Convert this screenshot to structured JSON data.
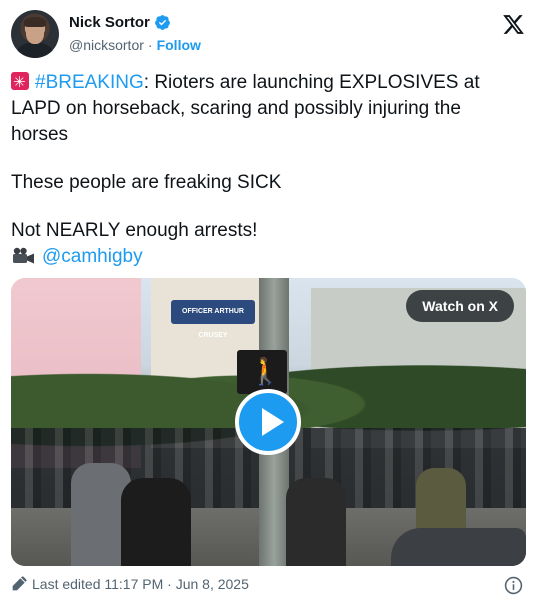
{
  "author": {
    "name": "Nick Sortor",
    "handle": "@nicksortor",
    "separator": "·",
    "follow_label": "Follow"
  },
  "tweet": {
    "line1_hashtag": "#BREAKING",
    "line1_rest": ": Rioters are launching EXPLOSIVES at",
    "line2": "LAPD on horseback, scaring and possibly injuring the",
    "line3": "horses",
    "line4": "These people are freaking SICK",
    "line5": "Not NEARLY enough arrests!",
    "mention": "@camhigby"
  },
  "media": {
    "watch_label": "Watch on X",
    "street_sign": "OFFICER ARTHUR CRUSEY"
  },
  "footer": {
    "edited_text": "Last edited 11:17 PM · Jun 8, 2025"
  },
  "icons": {
    "verified": "verified-badge-icon",
    "x_logo": "x-logo-icon",
    "siren": "rotating-light-emoji",
    "camera": "movie-camera-emoji",
    "pencil": "pencil-icon",
    "info": "info-icon",
    "play": "play-icon"
  },
  "colors": {
    "accent": "#1d9bf0",
    "text": "#0f1419",
    "muted": "#536471"
  }
}
